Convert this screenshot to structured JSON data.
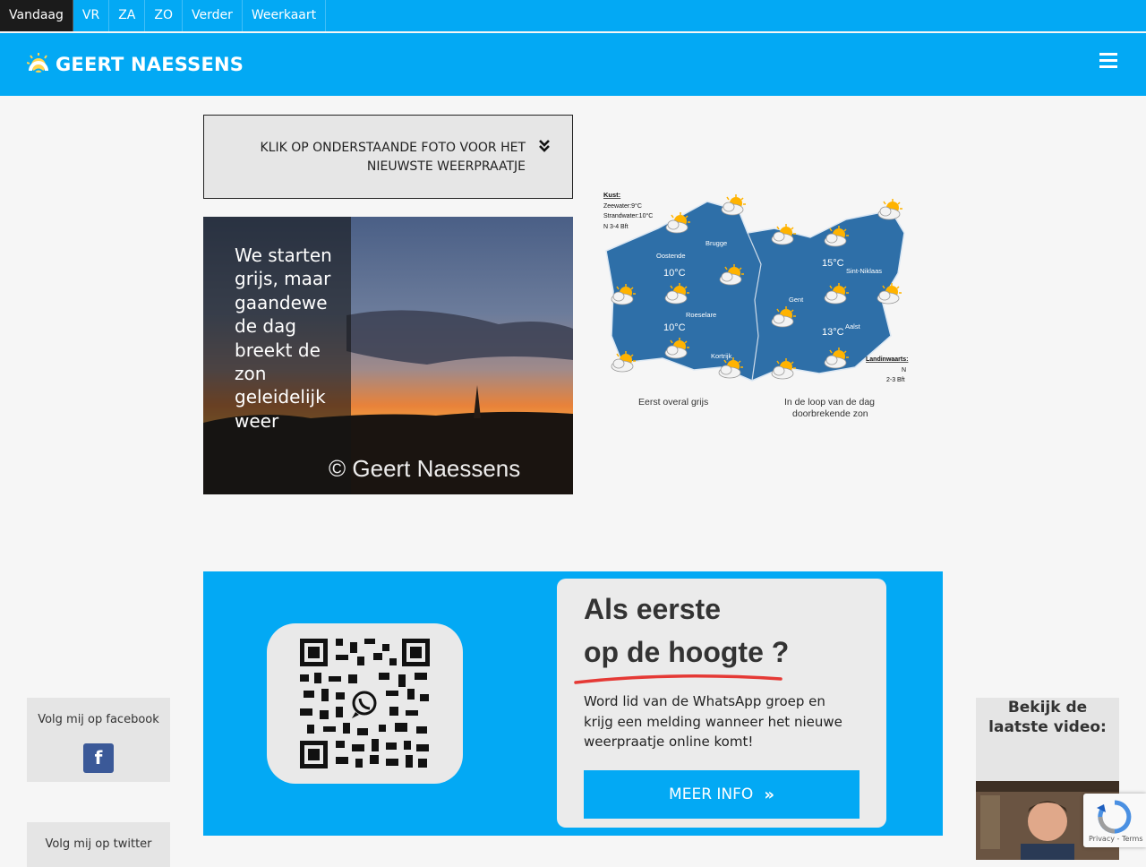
{
  "tabs": [
    {
      "label": "Vandaag",
      "active": true
    },
    {
      "label": "VR"
    },
    {
      "label": "ZA"
    },
    {
      "label": "ZO"
    },
    {
      "label": "Verder"
    },
    {
      "label": "Weerkaart"
    }
  ],
  "header": {
    "logo_text": "GEERT NAESSENS",
    "menu_icon": "hamburger-icon"
  },
  "banner": {
    "text_line1": "KLIK OP ONDERSTAANDE FOTO VOOR HET",
    "text_line2": "NIEUWSTE WEERPRAATJE",
    "icon": "double-chevron-down-icon"
  },
  "photo": {
    "caption": "We starten grijs, maar gaandewe de dag breekt de zon geleidelijk weer",
    "copyright": "© Geert Naessens"
  },
  "map": {
    "coast_title": "Kust:",
    "coast_lines": [
      "Zeewater:9°C",
      "Strandwater:10°C",
      "N 3-4 Bft"
    ],
    "cities": [
      "Brugge",
      "Oostende",
      "Roeselare",
      "Kortrijk",
      "Gent",
      "Sint-Niklaas",
      "Aalst"
    ],
    "temps": [
      "10°C",
      "10°C",
      "15°C",
      "13°C"
    ],
    "inland_title": "Landinwaarts:",
    "inland_lines": [
      "N",
      "2-3 Bft"
    ],
    "caption_left": "Eerst overal grijs",
    "caption_right_1": "In de loop van de dag",
    "caption_right_2": "doorbrekende zon"
  },
  "whatsapp": {
    "title_line1": "Als eerste",
    "title_line2": "op de hoogte ?",
    "body": "Word lid van de WhatsApp groep en krijg een melding wanneer het nieuwe weerpraatje online komt!",
    "button_label": "MEER INFO",
    "button_icon": "double-chevron-right-icon"
  },
  "social": {
    "facebook_label": "Volg mij op facebook",
    "facebook_icon_letter": "f",
    "twitter_label": "Volg mij op twitter"
  },
  "video": {
    "title": "Bekijk de laatste video:"
  },
  "recaptcha": {
    "links": "Privacy - Terms"
  },
  "colors": {
    "brand": "#03a9f4",
    "dark_tab": "#1b1b1b",
    "map_blue": "#2e75b6",
    "facebook": "#3b5998",
    "underline_red": "#e53935"
  }
}
